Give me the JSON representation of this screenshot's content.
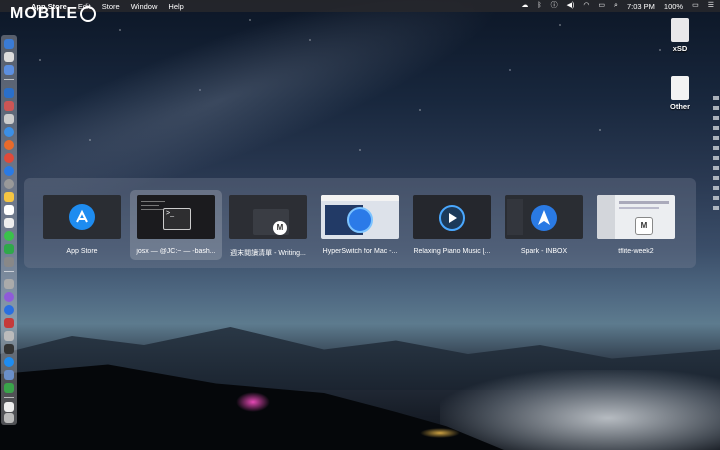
{
  "menubar": {
    "apple": "",
    "items": [
      "App Store",
      "Edit",
      "Store",
      "Window",
      "Help"
    ],
    "clock": "7:03 PM",
    "battery": "100%"
  },
  "watermark": {
    "text": "MOBILE"
  },
  "desktop": {
    "icons": [
      {
        "label": "xSD"
      },
      {
        "label": "Other"
      }
    ]
  },
  "switcher": {
    "windows": [
      {
        "label": "App Store",
        "icon": "app-store-icon",
        "selected": false
      },
      {
        "label": "josx — @JC:~ — -bash...",
        "icon": "terminal-icon",
        "selected": true
      },
      {
        "label": "週末閱讀清單 - Writing...",
        "icon": "writing-app-icon",
        "selected": false
      },
      {
        "label": "HyperSwitch for Mac -...",
        "icon": "safari-icon",
        "selected": false
      },
      {
        "label": "Relaxing Piano Music [...",
        "icon": "play-icon",
        "selected": false
      },
      {
        "label": "Spark - INBOX",
        "icon": "spark-icon",
        "selected": false
      },
      {
        "label": "tflite-week2",
        "icon": "document-icon",
        "selected": false
      }
    ]
  },
  "colors": {
    "accent_blue": "#1e8cf0",
    "spark_blue": "#2a7ae4"
  }
}
